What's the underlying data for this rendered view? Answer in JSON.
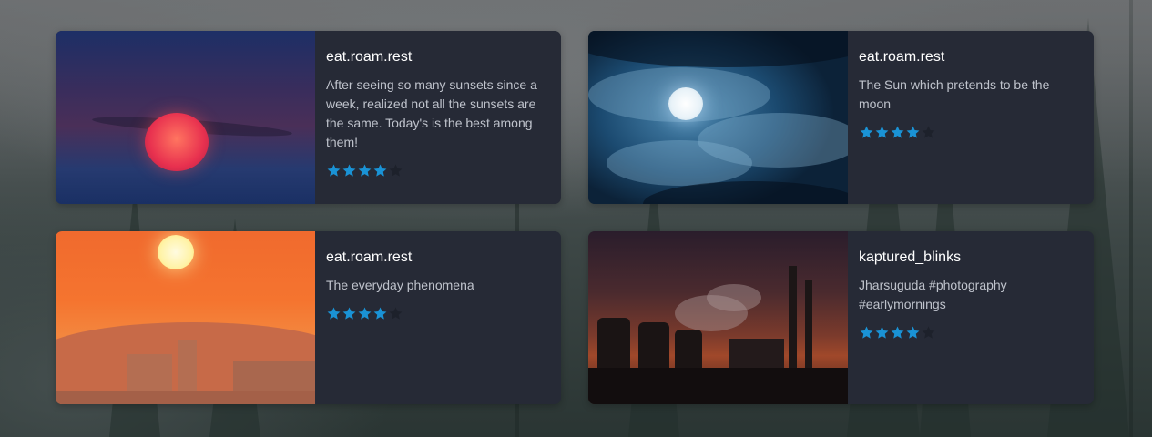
{
  "cards": [
    {
      "username": "eat.roam.rest",
      "caption": "After seeing so many sunsets since a week, realized not all the sunsets are the same. Today's is the best among them!",
      "rating": 4,
      "max_rating": 5
    },
    {
      "username": "eat.roam.rest",
      "caption": "The Sun which pretends to be the moon",
      "rating": 4,
      "max_rating": 5
    },
    {
      "username": "eat.roam.rest",
      "caption": "The everyday phenomena",
      "rating": 4,
      "max_rating": 5
    },
    {
      "username": "kaptured_blinks",
      "caption": "Jharsuguda #photography #earlymornings",
      "rating": 4,
      "max_rating": 5
    }
  ],
  "colors": {
    "card_bg": "#262a36",
    "star_filled": "#1a93d6",
    "star_empty": "#1d212b",
    "username": "#ffffff",
    "caption": "#bfc3cc"
  }
}
